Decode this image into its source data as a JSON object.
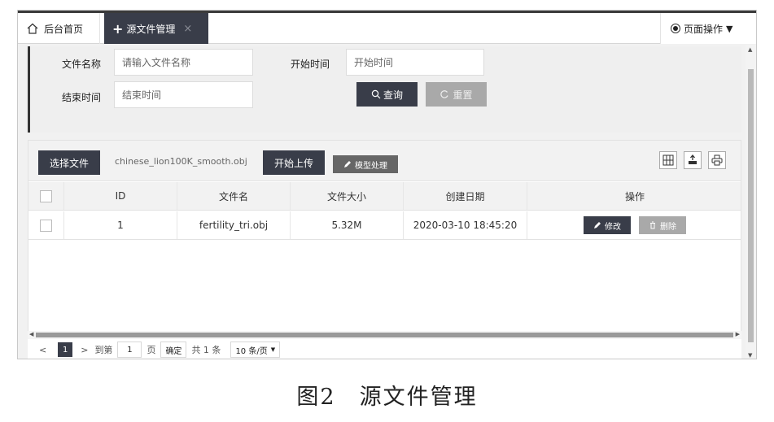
{
  "tabs": {
    "home_label": "后台首页",
    "active_label": "源文件管理",
    "close_glyph": "×",
    "plus_glyph": "+",
    "page_ops_label": "页面操作"
  },
  "search": {
    "filename_label": "文件名称",
    "filename_placeholder": "请输入文件名称",
    "start_label": "开始时间",
    "start_placeholder": "开始时间",
    "end_label": "结束时间",
    "end_placeholder": "结束时间",
    "query_label": "查询",
    "reset_label": "重置"
  },
  "toolbar": {
    "choose_label": "选择文件",
    "selected_file": "chinese_lion100K_smooth.obj",
    "upload_label": "开始上传",
    "model_label": "模型处理"
  },
  "table": {
    "headers": [
      "ID",
      "文件名",
      "文件大小",
      "创建日期",
      "操作"
    ],
    "rows": [
      {
        "id": "1",
        "filename": "fertility_tri.obj",
        "size": "5.32M",
        "date": "2020-03-10 18:45:20",
        "edit": "修改",
        "delete": "删除"
      }
    ]
  },
  "pager": {
    "prev": "<",
    "current": "1",
    "next": ">",
    "goto_label": "到第",
    "goto_value": "1",
    "page_unit": "页",
    "confirm": "确定",
    "total": "共 1 条",
    "per_page": "10 条/页"
  },
  "caption": "图2　源文件管理"
}
